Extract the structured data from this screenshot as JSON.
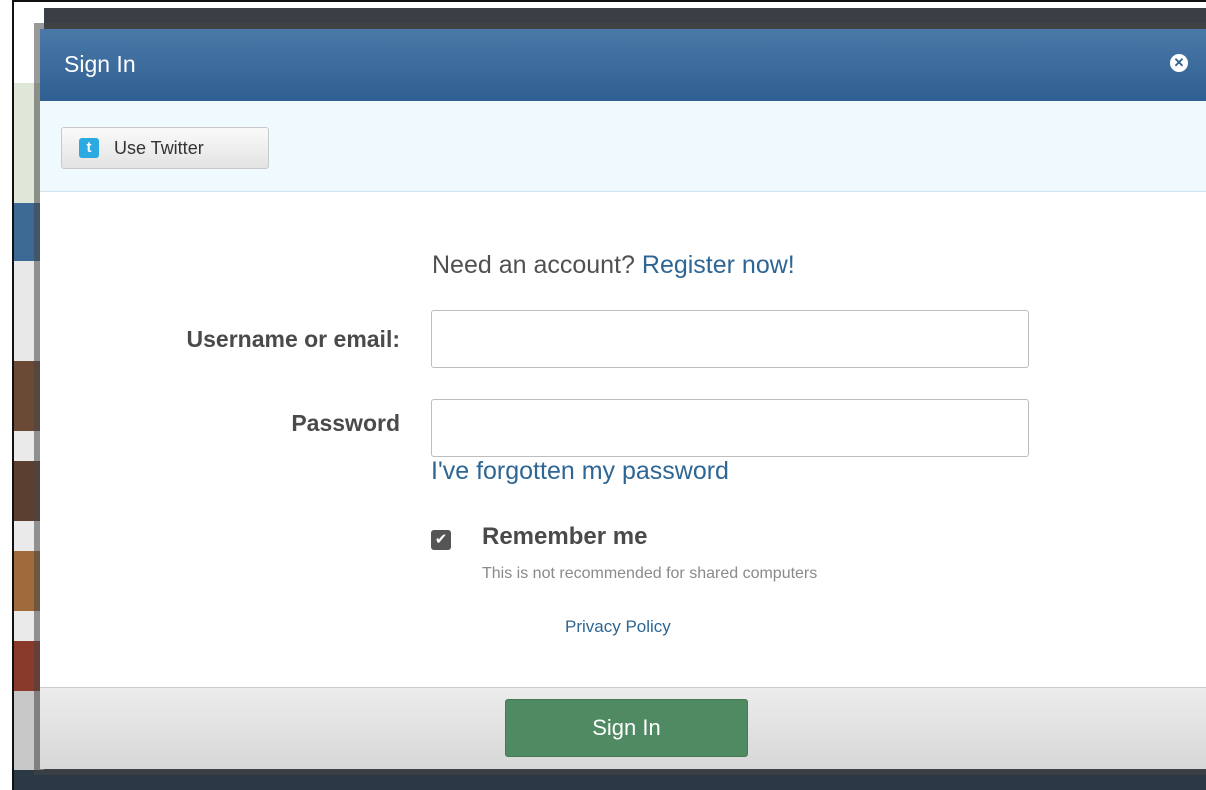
{
  "modal": {
    "title": "Sign In",
    "close_icon": "close-icon"
  },
  "social": {
    "twitter_label": "Use Twitter",
    "twitter_icon": "twitter-icon"
  },
  "form": {
    "register_prompt": "Need an account?",
    "register_link": "Register now!",
    "username_label": "Username or email:",
    "username_value": "",
    "password_label": "Password",
    "password_value": "",
    "forgot_link": "I've forgotten my password",
    "remember_label": "Remember me",
    "remember_checked": true,
    "remember_hint": "This is not recommended for shared computers",
    "privacy_link": "Privacy Policy"
  },
  "footer": {
    "signin_label": "Sign In"
  },
  "colors": {
    "header": "#2f5f91",
    "link": "#2d6694",
    "signin_button": "#4f8a63"
  }
}
